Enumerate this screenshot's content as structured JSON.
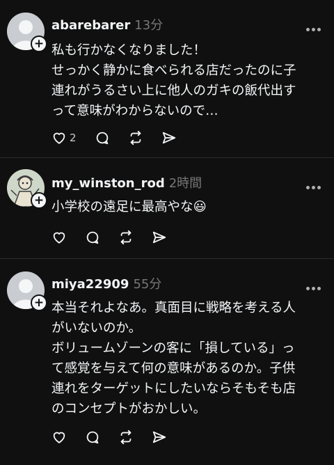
{
  "posts": [
    {
      "username": "abarebarer",
      "time": "13分",
      "lines": [
        "私も行かなくなりました！",
        "せっかく静かに食べられる店だったのに子",
        "連れがうるさい上に他人のガキの飯代出す",
        "って意味がわからないので…"
      ],
      "likes": "2",
      "avatar": "default-avatar"
    },
    {
      "username": "my_winston_rod",
      "time": "2時間",
      "lines": [
        "小学校の遠足に最高やな😃"
      ],
      "likes": "",
      "avatar": "drawing-avatar"
    },
    {
      "username": "miya22909",
      "time": "55分",
      "lines": [
        "本当それよなあ。真面目に戦略を考える人",
        "がいないのか。",
        "ボリュームゾーンの客に「損している」っ",
        "て感覚を与えて何の意味があるのか。子供",
        "連れをターゲットにしたいならそもそも店",
        "のコンセプトがおかしい。"
      ],
      "likes": "",
      "avatar": "default-avatar"
    }
  ],
  "icons": {
    "like": "heart-icon",
    "reply": "comment-icon",
    "repost": "repost-icon",
    "share": "send-icon",
    "more": "more-icon",
    "follow": "plus-icon"
  }
}
